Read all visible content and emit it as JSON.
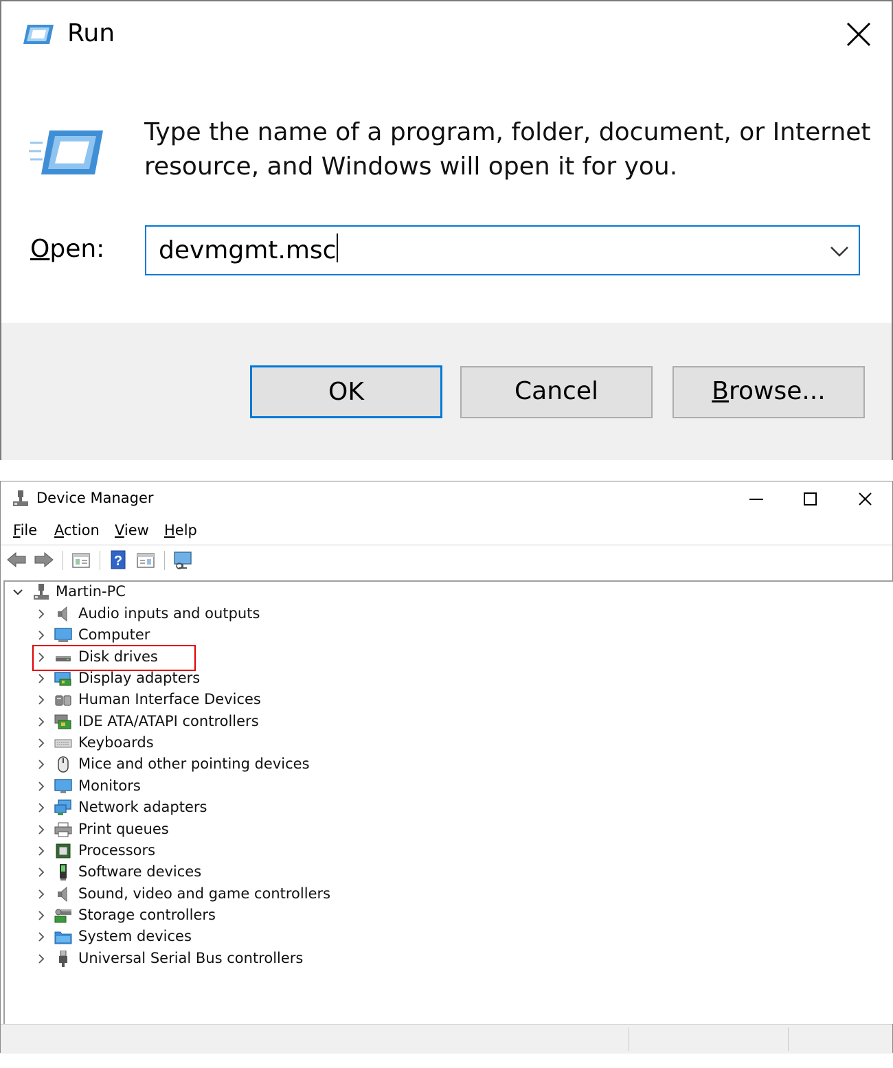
{
  "run_dialog": {
    "title": "Run",
    "description": "Type the name of a program, folder, document, or Internet resource, and Windows will open it for you.",
    "open_label_mnemonic": "O",
    "open_label_rest": "pen:",
    "open_value": "devmgmt.msc",
    "buttons": {
      "ok": "OK",
      "cancel": "Cancel",
      "browse_mnemonic": "B",
      "browse_rest": "rowse..."
    },
    "accent_color": "#0078d7"
  },
  "device_manager": {
    "title": "Device Manager",
    "menu": [
      {
        "mnemonic": "F",
        "rest": "ile"
      },
      {
        "mnemonic": "A",
        "rest": "ction"
      },
      {
        "mnemonic": "V",
        "rest": "iew"
      },
      {
        "mnemonic": "H",
        "rest": "elp"
      }
    ],
    "toolbar_icons": [
      "back-arrow-icon",
      "forward-arrow-icon",
      "properties-icon",
      "help-icon",
      "view-icon",
      "monitor-scan-icon"
    ],
    "tree": {
      "root": "Martin-PC",
      "items": [
        {
          "label": "Audio inputs and outputs",
          "icon": "speaker-icon"
        },
        {
          "label": "Computer",
          "icon": "computer-icon"
        },
        {
          "label": "Disk drives",
          "icon": "disk-drive-icon"
        },
        {
          "label": "Display adapters",
          "icon": "display-adapter-icon"
        },
        {
          "label": "Human Interface Devices",
          "icon": "hid-icon"
        },
        {
          "label": "IDE ATA/ATAPI controllers",
          "icon": "ide-controller-icon"
        },
        {
          "label": "Keyboards",
          "icon": "keyboard-icon"
        },
        {
          "label": "Mice and other pointing devices",
          "icon": "mouse-icon"
        },
        {
          "label": "Monitors",
          "icon": "monitor-icon"
        },
        {
          "label": "Network adapters",
          "icon": "network-adapter-icon"
        },
        {
          "label": "Print queues",
          "icon": "printer-icon"
        },
        {
          "label": "Processors",
          "icon": "processor-icon"
        },
        {
          "label": "Software devices",
          "icon": "software-device-icon"
        },
        {
          "label": "Sound, video and game controllers",
          "icon": "speaker-icon"
        },
        {
          "label": "Storage controllers",
          "icon": "storage-controller-icon"
        },
        {
          "label": "System devices",
          "icon": "folder-icon"
        },
        {
          "label": "Universal Serial Bus controllers",
          "icon": "usb-icon"
        }
      ]
    },
    "highlighted_item": "Disk drives",
    "highlight_color": "#e00000"
  }
}
